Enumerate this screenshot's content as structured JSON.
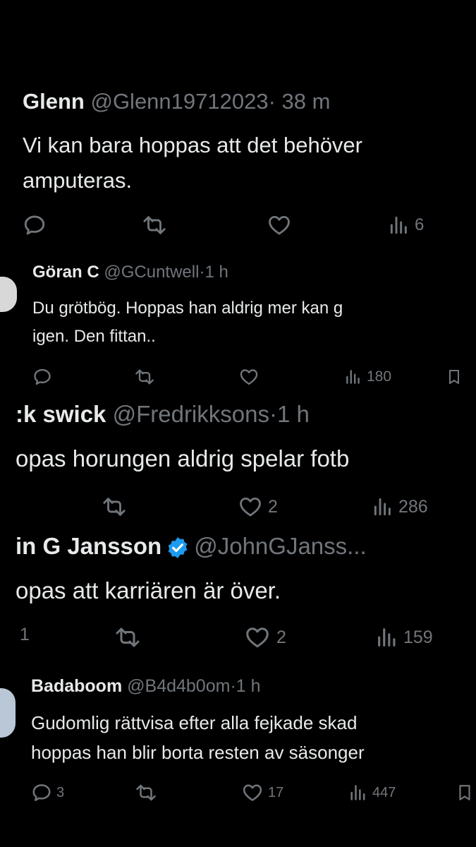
{
  "tweets": [
    {
      "name": "Glenn",
      "handle": "@Glenn19712023",
      "sep": "·",
      "time": "38 m",
      "lines": [
        "Vi kan bara hoppas att det behöver",
        "amputeras."
      ],
      "views": "6"
    },
    {
      "name": "Göran C",
      "handle": "@GCuntwell",
      "sep": "·",
      "time": "1 h",
      "lines": [
        "Du grötbög. Hoppas han aldrig mer kan g",
        "igen. Den fittan.."
      ],
      "views": "180"
    },
    {
      "name": ":k swick",
      "handle": "@Fredrikksons",
      "sep": "·",
      "time": "1 h",
      "lines": [
        "opas horungen aldrig spelar fotb"
      ],
      "likes": "2",
      "views": "286"
    },
    {
      "name": "in G Jansson",
      "handle": "@JohnGJanss...",
      "lines": [
        "opas att karriären är över."
      ],
      "replies": "1",
      "likes": "2",
      "views": "159"
    },
    {
      "name": "Badaboom",
      "handle": "@B4d4b0om",
      "sep": "·",
      "time": "1 h",
      "lines": [
        "Gudomlig rättvisa efter alla fejkade skad",
        "hoppas han blir borta resten av säsonger"
      ],
      "replies": "3",
      "likes": "17",
      "views": "447"
    }
  ],
  "colors": {
    "background": "#000000",
    "text": "#e7e9ea",
    "muted": "#71767b",
    "verified": "#1d9bf0"
  }
}
